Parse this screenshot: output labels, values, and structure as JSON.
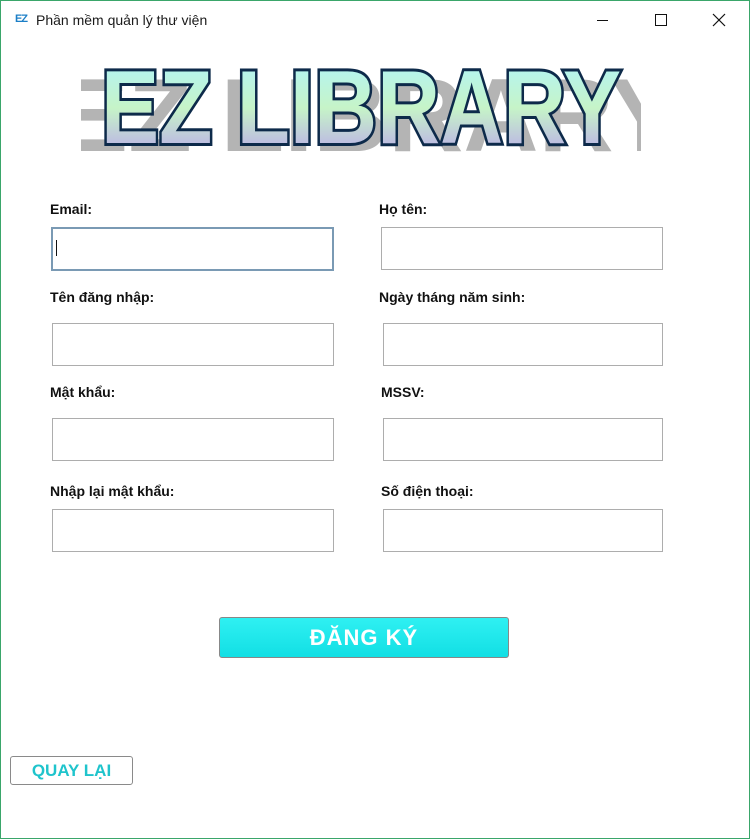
{
  "window": {
    "title": "Phần mềm quản lý thư viện",
    "app_icon_text": "EZ"
  },
  "logo": {
    "text": "EZ LIBRARY"
  },
  "form": {
    "email_label": "Email:",
    "email_value": "",
    "fullname_label": "Họ tên:",
    "fullname_value": "",
    "username_label": "Tên đăng nhập:",
    "username_value": "",
    "birthdate_label": "Ngày tháng năm sinh:",
    "birthdate_value": "",
    "password_label": "Mật khẩu:",
    "password_value": "",
    "student_id_label": "MSSV:",
    "student_id_value": "",
    "confirm_password_label": "Nhập lại mật khẩu:",
    "confirm_password_value": "",
    "phone_label": "Số điện thoại:",
    "phone_value": ""
  },
  "actions": {
    "register_label": "ĐĂNG KÝ",
    "back_label": "QUAY LẠI"
  },
  "colors": {
    "window_border": "#3aa66a",
    "register_button": "#1ee6ea",
    "back_text": "#1fc4cc",
    "logo_outline": "#0d2a4a",
    "logo_gradient_top": "#aef5ff",
    "logo_gradient_bottom": "#b89cf0"
  },
  "icons": {
    "minimize": "minimize-icon",
    "maximize": "maximize-icon",
    "close": "close-icon"
  }
}
